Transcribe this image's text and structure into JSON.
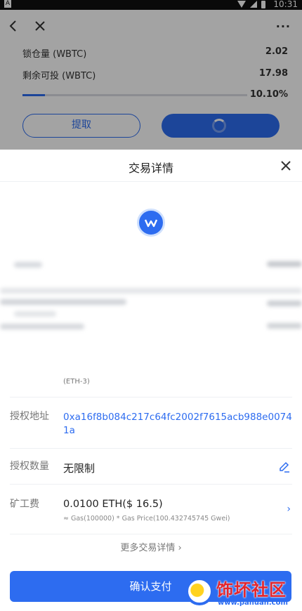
{
  "status_bar": {
    "time": "10:31",
    "left_badge": "A"
  },
  "bg": {
    "rows": [
      {
        "label": "锁仓量 (WBTC)",
        "value": "2.02"
      },
      {
        "label": "剩余可投 (WBTC)",
        "value": "17.98"
      }
    ],
    "progress_percent_text": "10.10%",
    "progress_value": 0.101,
    "withdraw_label": "提取",
    "more_label": "···"
  },
  "sheet": {
    "title": "交易详情",
    "token_network": "(ETH-3)",
    "auth_address_label": "授权地址",
    "auth_address": "0xa16f8b084c217c64fc2002f7615acb988e00741a",
    "auth_amount_label": "授权数量",
    "auth_amount": "无限制",
    "fee_label": "矿工费",
    "fee_value": "0.0100 ETH($ 16.5)",
    "fee_detail": "≈ Gas(100000) * Gas Price(100.432745745 Gwei)",
    "more_details": "更多交易详情 ›",
    "confirm_label": "确认支付"
  },
  "watermark": {
    "text": "饰坏社区",
    "url": "www.pañuan.com"
  },
  "colors": {
    "accent": "#2d6cf0",
    "watermark_red": "#e3262d"
  }
}
